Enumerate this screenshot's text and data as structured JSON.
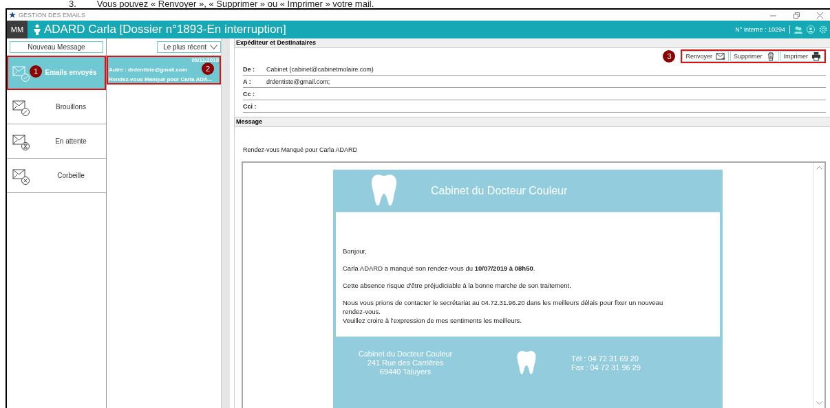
{
  "doc_line": {
    "number": "3.",
    "text": "Vous pouvez « Renvoyer », « Supprimer » ou « Imprimer » votre mail."
  },
  "window": {
    "title": "GESTION DES EMAILS"
  },
  "header": {
    "user": "MM",
    "patient": "ADARD Carla [Dossier n°1893-En interruption]",
    "internal_no": "N° interne :  10294"
  },
  "new_message": "Nouveau Message",
  "sort": {
    "value": "Le plus récent"
  },
  "folders": [
    {
      "label": "Emails envoyés",
      "kind": "sent",
      "selected": true,
      "callout": "1"
    },
    {
      "label": "Brouillons",
      "kind": "draft",
      "selected": false
    },
    {
      "label": "En attente",
      "kind": "pending",
      "selected": false
    },
    {
      "label": "Corbeille",
      "kind": "trash",
      "selected": false
    }
  ],
  "messages": [
    {
      "date": "05/11/2019",
      "from": "Autre : drdentiste@gmail.com",
      "subject": "Rendez-vous Manqué pour Carla ADA...",
      "selected": true,
      "callout": "2"
    }
  ],
  "recipients": {
    "title": "Expéditeur et Destinataires",
    "actions_callout": "3",
    "actions": [
      {
        "label": "Renvoyer",
        "kind": "resend"
      },
      {
        "label": "Supprimer",
        "kind": "trash"
      },
      {
        "label": "Imprimer",
        "kind": "print"
      }
    ],
    "fields": [
      {
        "label": "De :",
        "value": "Cabinet (cabinet@cabinetmolaire.com)"
      },
      {
        "label": "A :",
        "value": "drdentiste@gmail.com;"
      },
      {
        "label": "Cc :"
      },
      {
        "label": "Cci :"
      }
    ]
  },
  "message": {
    "title": "Message",
    "subject": "Rendez-vous Manqué pour Carla ADARD",
    "email": {
      "banner": "Cabinet du Docteur Couleur",
      "paragraphs": [
        "Bonjour,",
        "Carla ADARD a manqué son rendez-vous du **10/07/2019 à 08h50**.",
        "Cette absence risque d'être préjudiciable à la bonne marche de son traitement.",
        "Nous vous prions de contacter le secrétariat au 04.72.31.96.20 dans les meilleurs délais pour fixer un nouveau rendez-vous.\nVeuillez croire à l'expression de mes sentiments les meilleurs."
      ],
      "address": [
        "Cabinet du Docteur Couleur",
        "241 Rue des Carrières",
        "69440 Taluyers"
      ],
      "contact": [
        "Tél : 04 72 31 69 20",
        "Fax : 04 72 31 96 29"
      ]
    }
  }
}
